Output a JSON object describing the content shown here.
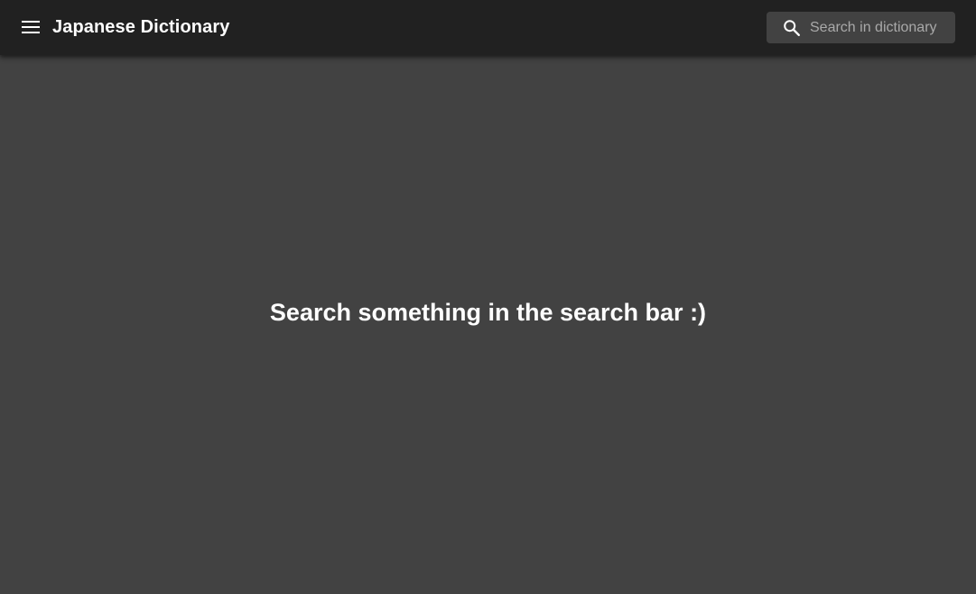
{
  "header": {
    "menu_icon": "menu-icon",
    "title": "Japanese Dictionary",
    "search": {
      "icon": "search-icon",
      "placeholder": "Search in dictionary",
      "value": ""
    }
  },
  "main": {
    "empty_message": "Search something in the search bar :)"
  },
  "colors": {
    "app_bar": "#212121",
    "background": "#424242",
    "search_box": "#424242",
    "text": "#ffffff",
    "placeholder": "#a9a9a9"
  }
}
